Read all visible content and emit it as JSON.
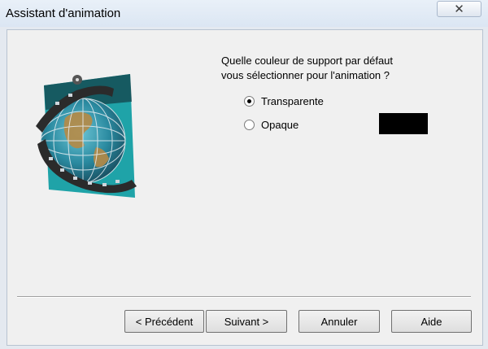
{
  "window": {
    "title": "Assistant d'animation",
    "close_icon": "close-icon"
  },
  "question": {
    "line1": "Quelle couleur de support par défaut",
    "line2": "vous sélectionner pour l'animation ?"
  },
  "options": [
    {
      "label": "Transparente",
      "checked": true
    },
    {
      "label": "Opaque",
      "checked": false
    }
  ],
  "swatch_color": "#000000",
  "buttons": {
    "previous": "< Précédent",
    "next": "Suivant >",
    "cancel": "Annuler",
    "help": "Aide"
  }
}
